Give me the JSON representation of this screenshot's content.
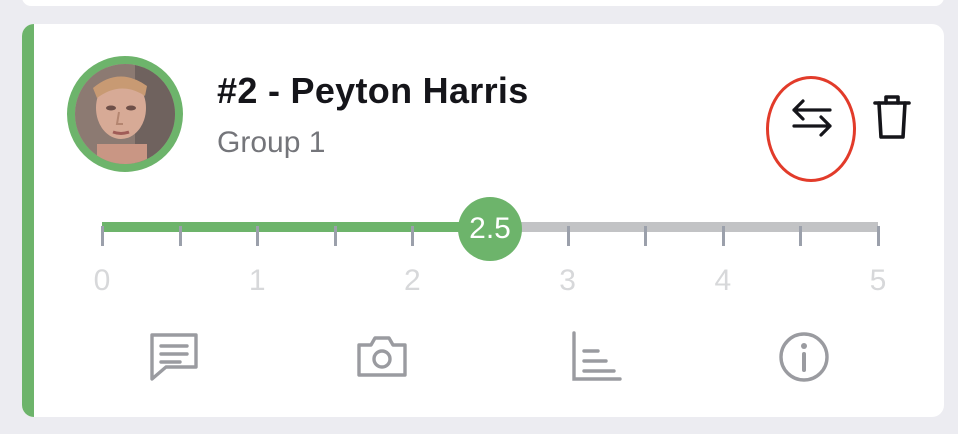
{
  "player": {
    "title": "#2 - Peyton Harris",
    "group": "Group 1"
  },
  "slider": {
    "min": 0,
    "max": 5,
    "step": 0.5,
    "value": 2.5,
    "value_label": "2.5",
    "tick_labels": [
      "0",
      "1",
      "2",
      "3",
      "4",
      "5"
    ]
  },
  "icons": {
    "swap": "swap-arrows-icon",
    "delete": "trash-icon",
    "comment": "comment-icon",
    "camera": "camera-icon",
    "stats": "bar-chart-icon",
    "info": "info-icon"
  },
  "colors": {
    "accent": "#6db46b",
    "track": "#c2c3c5",
    "highlight_circle": "#e23b2a",
    "title": "#15151a",
    "subtitle": "#74757a",
    "action_icon": "#9a9ba0"
  }
}
